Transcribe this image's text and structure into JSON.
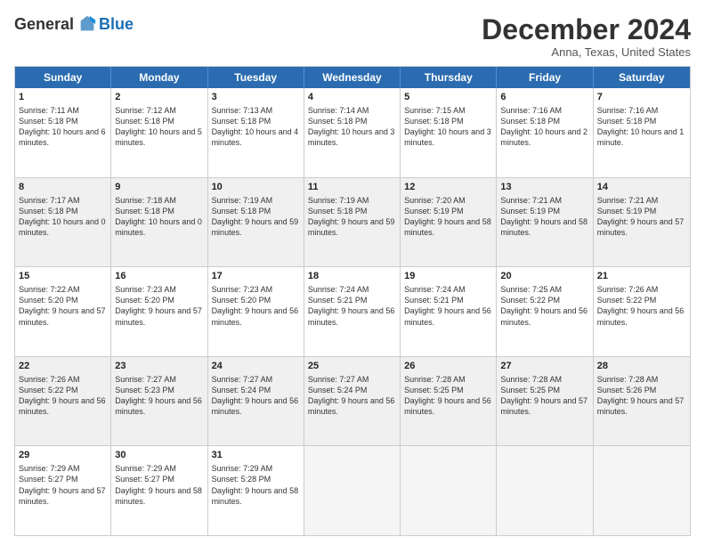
{
  "logo": {
    "general": "General",
    "blue": "Blue"
  },
  "header": {
    "month": "December 2024",
    "location": "Anna, Texas, United States"
  },
  "weekdays": [
    "Sunday",
    "Monday",
    "Tuesday",
    "Wednesday",
    "Thursday",
    "Friday",
    "Saturday"
  ],
  "rows": [
    [
      {
        "day": "1",
        "sunrise": "7:11 AM",
        "sunset": "5:18 PM",
        "daylight": "10 hours and 6 minutes."
      },
      {
        "day": "2",
        "sunrise": "7:12 AM",
        "sunset": "5:18 PM",
        "daylight": "10 hours and 5 minutes."
      },
      {
        "day": "3",
        "sunrise": "7:13 AM",
        "sunset": "5:18 PM",
        "daylight": "10 hours and 4 minutes."
      },
      {
        "day": "4",
        "sunrise": "7:14 AM",
        "sunset": "5:18 PM",
        "daylight": "10 hours and 3 minutes."
      },
      {
        "day": "5",
        "sunrise": "7:15 AM",
        "sunset": "5:18 PM",
        "daylight": "10 hours and 3 minutes."
      },
      {
        "day": "6",
        "sunrise": "7:16 AM",
        "sunset": "5:18 PM",
        "daylight": "10 hours and 2 minutes."
      },
      {
        "day": "7",
        "sunrise": "7:16 AM",
        "sunset": "5:18 PM",
        "daylight": "10 hours and 1 minute."
      }
    ],
    [
      {
        "day": "8",
        "sunrise": "7:17 AM",
        "sunset": "5:18 PM",
        "daylight": "10 hours and 0 minutes."
      },
      {
        "day": "9",
        "sunrise": "7:18 AM",
        "sunset": "5:18 PM",
        "daylight": "10 hours and 0 minutes."
      },
      {
        "day": "10",
        "sunrise": "7:19 AM",
        "sunset": "5:18 PM",
        "daylight": "9 hours and 59 minutes."
      },
      {
        "day": "11",
        "sunrise": "7:19 AM",
        "sunset": "5:18 PM",
        "daylight": "9 hours and 59 minutes."
      },
      {
        "day": "12",
        "sunrise": "7:20 AM",
        "sunset": "5:19 PM",
        "daylight": "9 hours and 58 minutes."
      },
      {
        "day": "13",
        "sunrise": "7:21 AM",
        "sunset": "5:19 PM",
        "daylight": "9 hours and 58 minutes."
      },
      {
        "day": "14",
        "sunrise": "7:21 AM",
        "sunset": "5:19 PM",
        "daylight": "9 hours and 57 minutes."
      }
    ],
    [
      {
        "day": "15",
        "sunrise": "7:22 AM",
        "sunset": "5:20 PM",
        "daylight": "9 hours and 57 minutes."
      },
      {
        "day": "16",
        "sunrise": "7:23 AM",
        "sunset": "5:20 PM",
        "daylight": "9 hours and 57 minutes."
      },
      {
        "day": "17",
        "sunrise": "7:23 AM",
        "sunset": "5:20 PM",
        "daylight": "9 hours and 56 minutes."
      },
      {
        "day": "18",
        "sunrise": "7:24 AM",
        "sunset": "5:21 PM",
        "daylight": "9 hours and 56 minutes."
      },
      {
        "day": "19",
        "sunrise": "7:24 AM",
        "sunset": "5:21 PM",
        "daylight": "9 hours and 56 minutes."
      },
      {
        "day": "20",
        "sunrise": "7:25 AM",
        "sunset": "5:22 PM",
        "daylight": "9 hours and 56 minutes."
      },
      {
        "day": "21",
        "sunrise": "7:26 AM",
        "sunset": "5:22 PM",
        "daylight": "9 hours and 56 minutes."
      }
    ],
    [
      {
        "day": "22",
        "sunrise": "7:26 AM",
        "sunset": "5:22 PM",
        "daylight": "9 hours and 56 minutes."
      },
      {
        "day": "23",
        "sunrise": "7:27 AM",
        "sunset": "5:23 PM",
        "daylight": "9 hours and 56 minutes."
      },
      {
        "day": "24",
        "sunrise": "7:27 AM",
        "sunset": "5:24 PM",
        "daylight": "9 hours and 56 minutes."
      },
      {
        "day": "25",
        "sunrise": "7:27 AM",
        "sunset": "5:24 PM",
        "daylight": "9 hours and 56 minutes."
      },
      {
        "day": "26",
        "sunrise": "7:28 AM",
        "sunset": "5:25 PM",
        "daylight": "9 hours and 56 minutes."
      },
      {
        "day": "27",
        "sunrise": "7:28 AM",
        "sunset": "5:25 PM",
        "daylight": "9 hours and 57 minutes."
      },
      {
        "day": "28",
        "sunrise": "7:28 AM",
        "sunset": "5:26 PM",
        "daylight": "9 hours and 57 minutes."
      }
    ],
    [
      {
        "day": "29",
        "sunrise": "7:29 AM",
        "sunset": "5:27 PM",
        "daylight": "9 hours and 57 minutes."
      },
      {
        "day": "30",
        "sunrise": "7:29 AM",
        "sunset": "5:27 PM",
        "daylight": "9 hours and 58 minutes."
      },
      {
        "day": "31",
        "sunrise": "7:29 AM",
        "sunset": "5:28 PM",
        "daylight": "9 hours and 58 minutes."
      },
      null,
      null,
      null,
      null
    ]
  ]
}
